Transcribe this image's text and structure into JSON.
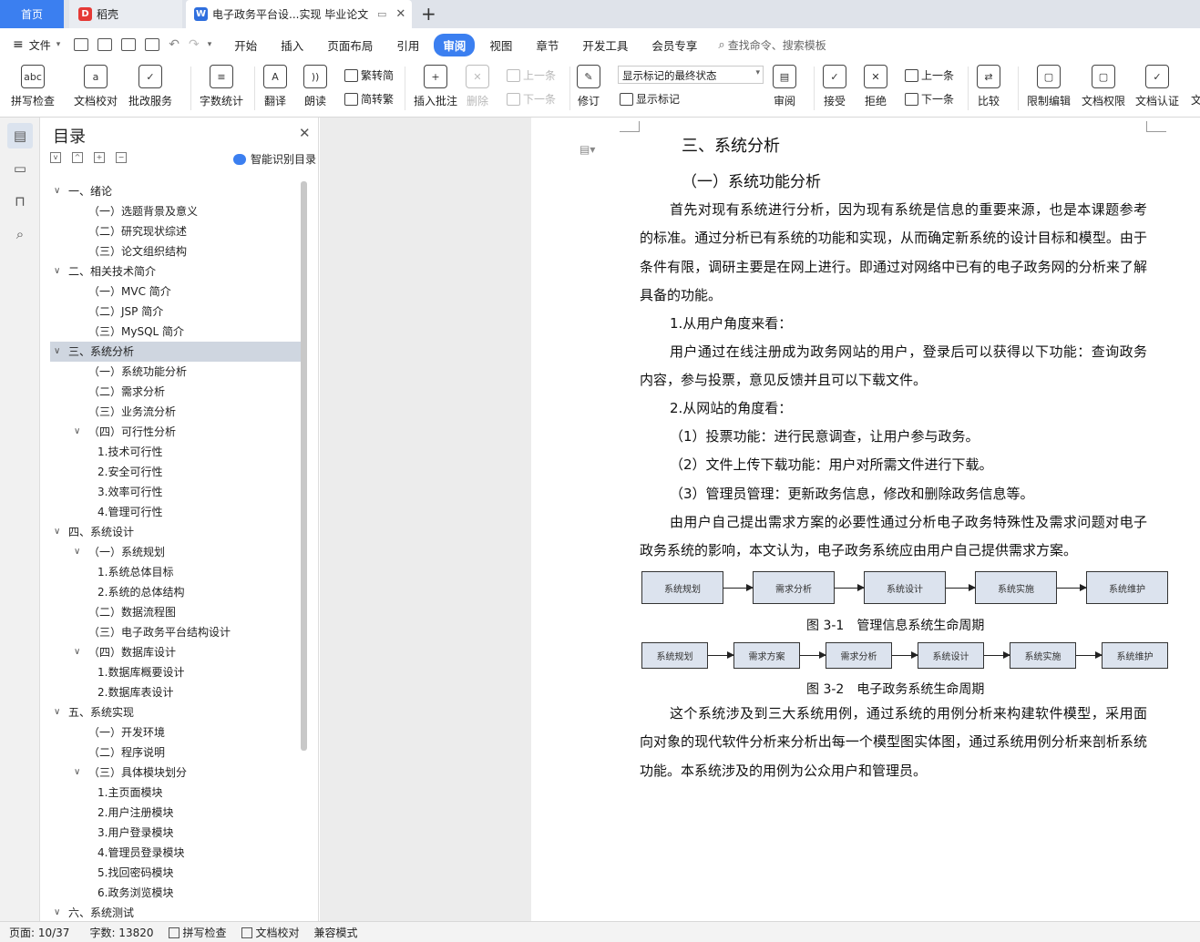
{
  "tabs": {
    "home": "首页",
    "daoke": "稻壳",
    "doc_title": "电子政务平台设...实现 毕业论文",
    "close": "✕",
    "add": "+"
  },
  "menu": {
    "file": "文件",
    "tabs": [
      "开始",
      "插入",
      "页面布局",
      "引用",
      "审阅",
      "视图",
      "章节",
      "开发工具",
      "会员专享"
    ],
    "active_tab": "审阅",
    "search": "查找命令、搜索模板"
  },
  "ribbon": {
    "spell": "拼写检查",
    "doc_check": "文档校对",
    "review_service": "批改服务",
    "word_count": "字数统计",
    "translate": "翻译",
    "read": "朗读",
    "fan_jian": "繁转简",
    "jian_fan": "简转繁",
    "insert_comment": "插入批注",
    "delete": "删除",
    "prev1": "上一条",
    "next1": "下一条",
    "revise": "修订",
    "markup_select": "显示标记的最终状态",
    "show_markup": "显示标记",
    "review": "审阅",
    "accept": "接受",
    "reject": "拒绝",
    "prev2": "上一条",
    "next2": "下一条",
    "compare": "比较",
    "restrict_edit": "限制编辑",
    "doc_permission": "文档权限",
    "doc_cert": "文档认证",
    "cut": "文"
  },
  "toc": {
    "title": "目录",
    "smart": "智能识别目录",
    "items": [
      {
        "t": "一、绪论",
        "lv": 0,
        "arrow": "v"
      },
      {
        "t": "（一）选题背景及意义",
        "lv": 1
      },
      {
        "t": "（二）研究现状综述",
        "lv": 1
      },
      {
        "t": "（三）论文组织结构",
        "lv": 1
      },
      {
        "t": "二、相关技术简介",
        "lv": 0,
        "arrow": "v"
      },
      {
        "t": "（一）MVC 简介",
        "lv": 1
      },
      {
        "t": "（二）JSP 简介",
        "lv": 1
      },
      {
        "t": "（三）MySQL 简介",
        "lv": 1
      },
      {
        "t": "三、系统分析",
        "lv": 0,
        "arrow": "v",
        "selected": true
      },
      {
        "t": "（一）系统功能分析",
        "lv": 1
      },
      {
        "t": "（二）需求分析",
        "lv": 1
      },
      {
        "t": "（三）业务流分析",
        "lv": 1
      },
      {
        "t": "（四）可行性分析",
        "lv": 1,
        "arrow": "v"
      },
      {
        "t": "1.技术可行性",
        "lv": 2
      },
      {
        "t": "2.安全可行性",
        "lv": 2
      },
      {
        "t": "3.效率可行性",
        "lv": 2
      },
      {
        "t": "4.管理可行性",
        "lv": 2
      },
      {
        "t": "四、系统设计",
        "lv": 0,
        "arrow": "v"
      },
      {
        "t": "（一）系统规划",
        "lv": 1,
        "arrow": "v"
      },
      {
        "t": "1.系统总体目标",
        "lv": 2
      },
      {
        "t": "2.系统的总体结构",
        "lv": 2
      },
      {
        "t": "（二）数据流程图",
        "lv": 1
      },
      {
        "t": "（三）电子政务平台结构设计",
        "lv": 1
      },
      {
        "t": "（四）数据库设计",
        "lv": 1,
        "arrow": "v"
      },
      {
        "t": "1.数据库概要设计",
        "lv": 2
      },
      {
        "t": "2.数据库表设计",
        "lv": 2
      },
      {
        "t": "五、系统实现",
        "lv": 0,
        "arrow": "v"
      },
      {
        "t": "（一）开发环境",
        "lv": 1
      },
      {
        "t": "（二）程序说明",
        "lv": 1
      },
      {
        "t": "（三）具体模块划分",
        "lv": 1,
        "arrow": "v"
      },
      {
        "t": "1.主页面模块",
        "lv": 2
      },
      {
        "t": "2.用户注册模块",
        "lv": 2
      },
      {
        "t": "3.用户登录模块",
        "lv": 2
      },
      {
        "t": "4.管理员登录模块",
        "lv": 2
      },
      {
        "t": "5.找回密码模块",
        "lv": 2
      },
      {
        "t": "6.政务浏览模块",
        "lv": 2
      },
      {
        "t": "六、系统测试",
        "lv": 0,
        "arrow": "v"
      }
    ]
  },
  "doc": {
    "h1": "三、系统分析",
    "h2": "（一）系统功能分析",
    "p1": "首先对现有系统进行分析，因为现有系统是信息的重要来源，也是本课题参考的标准。通过分析已有系统的功能和实现，从而确定新系统的设计目标和模型。由于条件有限，调研主要是在网上进行。即通过对网络中已有的电子政务网的分析来了解具备的功能。",
    "p2": "1.从用户角度来看：",
    "p3": "用户通过在线注册成为政务网站的用户，登录后可以获得以下功能：查询政务内容，参与投票，意见反馈并且可以下载文件。",
    "p4": "2.从网站的角度看：",
    "p5": "（1）投票功能：进行民意调查，让用户参与政务。",
    "p6": "（2）文件上传下载功能：用户对所需文件进行下载。",
    "p7": "（3）管理员管理：更新政务信息，修改和删除政务信息等。",
    "p8": "由用户自己提出需求方案的必要性通过分析电子政务特殊性及需求问题对电子政务系统的影响，本文认为，电子政务系统应由用户自己提供需求方案。",
    "fig1_boxes": [
      "系统规划",
      "需求分析",
      "系统设计",
      "系统实施",
      "系统维护"
    ],
    "fig1_cap": "图 3-1　管理信息系统生命周期",
    "fig2_boxes": [
      "系统规划",
      "需求方案",
      "需求分析",
      "系统设计",
      "系统实施",
      "系统维护"
    ],
    "fig2_cap": "图 3-2　电子政务系统生命周期",
    "p9": "这个系统涉及到三大系统用例，通过系统的用例分析来构建软件模型，采用面向对象的现代软件分析来分析出每一个模型图实体图，通过系统用例分析来剖析系统功能。本系统涉及的用例为公众用户和管理员。"
  },
  "status": {
    "page": "页面: 10/37",
    "words": "字数: 13820",
    "spell": "拼写检查",
    "check": "文档校对",
    "compat": "兼容模式"
  }
}
